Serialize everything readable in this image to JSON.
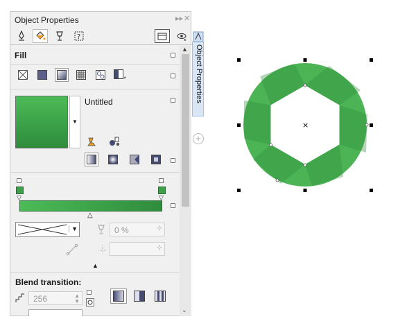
{
  "panel": {
    "title": "Object Properties",
    "title_controls": {
      "collapse": "▸▸",
      "close": "✕"
    },
    "tabs": [
      {
        "icon": "pen-outline-icon"
      },
      {
        "icon": "paint-bucket-icon",
        "active": true
      },
      {
        "icon": "transparency-glass-icon"
      },
      {
        "icon": "summary-icon"
      }
    ],
    "fill": {
      "label": "Fill",
      "types": [
        "no-fill-icon",
        "uniform-fill-icon",
        "fountain-fill-icon",
        "pattern-fill-icon",
        "texture-fill-icon",
        "postscript-fill-icon"
      ],
      "active_type": "fountain-fill-icon",
      "gradient_name": "Untitled",
      "start_color": "#4cbb57",
      "end_color": "#2f8c3c",
      "gradient_styles": [
        "linear",
        "elliptical",
        "conical",
        "rectangular"
      ],
      "transparency_value": "0 %"
    },
    "blend": {
      "label": "Blend transition:",
      "steps_value": "256"
    }
  },
  "side_tab": {
    "label": "Object Properties"
  },
  "object": {
    "fill_color": "#4cb455",
    "fill_shadow": "#3f9f4a"
  }
}
